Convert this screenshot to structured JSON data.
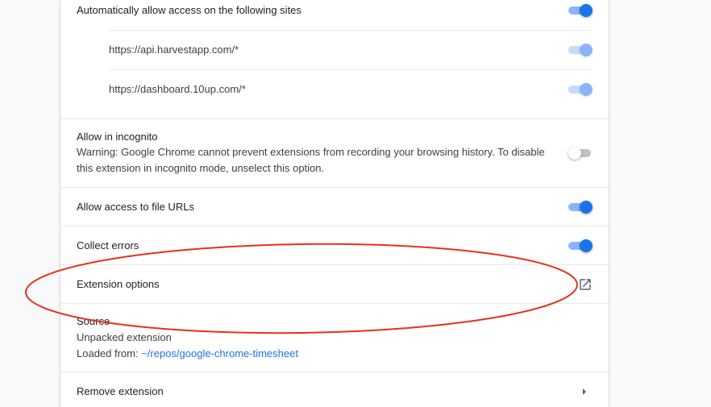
{
  "site_access": {
    "auto_allow_label": "Automatically allow access on the following sites",
    "sites": [
      "https://api.harvestapp.com/*",
      "https://dashboard.10up.com/*"
    ]
  },
  "incognito": {
    "label": "Allow in incognito",
    "warning": "Warning: Google Chrome cannot prevent extensions from recording your browsing history. To disable this extension in incognito mode, unselect this option."
  },
  "file_urls": {
    "label": "Allow access to file URLs"
  },
  "collect_errors": {
    "label": "Collect errors"
  },
  "extension_options": {
    "label": "Extension options"
  },
  "source": {
    "heading": "Source",
    "type": "Unpacked extension",
    "loaded_from_label": "Loaded from: ",
    "path": "~/repos/google-chrome-timesheet"
  },
  "remove": {
    "label": "Remove extension"
  },
  "toggles": {
    "auto_allow": true,
    "site_1": true,
    "site_2": true,
    "incognito": false,
    "file_urls": true,
    "collect_errors": true
  },
  "colors": {
    "accent": "#1a73e8",
    "annotation": "#e8301c"
  },
  "icons": {
    "open_external": "open-in-new-icon",
    "chevron": "chevron-right-icon"
  }
}
